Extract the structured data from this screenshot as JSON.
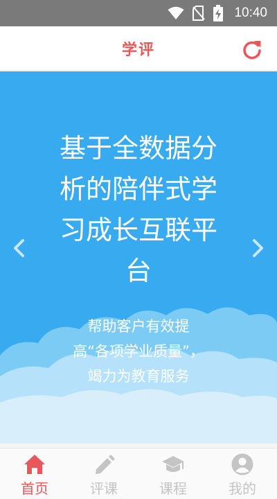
{
  "status_bar": {
    "time": "10:40",
    "icons": [
      "wifi-icon",
      "no-sim-icon",
      "battery-charging-icon"
    ]
  },
  "header": {
    "title": "学评",
    "refresh_icon": "refresh-icon"
  },
  "banner": {
    "heading_lines": [
      "基于全数据分",
      "析的陪伴式学",
      "习成长互联平",
      "台"
    ],
    "subtitle_lines": [
      "帮助客户有效提",
      "高“各项学业质量”，",
      "竭力为教育服务"
    ],
    "prev_icon": "chevron-left-icon",
    "next_icon": "chevron-right-icon",
    "background_color": "#38aaf0"
  },
  "bottom_nav": {
    "items": [
      {
        "label": "首页",
        "icon": "home-icon",
        "active": true
      },
      {
        "label": "评课",
        "icon": "pencil-icon",
        "active": false
      },
      {
        "label": "课程",
        "icon": "graduation-cap-icon",
        "active": false
      },
      {
        "label": "我的",
        "icon": "user-icon",
        "active": false
      }
    ]
  },
  "colors": {
    "accent": "#e8585a",
    "inactive": "#c4c4c4",
    "banner": "#38aaf0"
  }
}
